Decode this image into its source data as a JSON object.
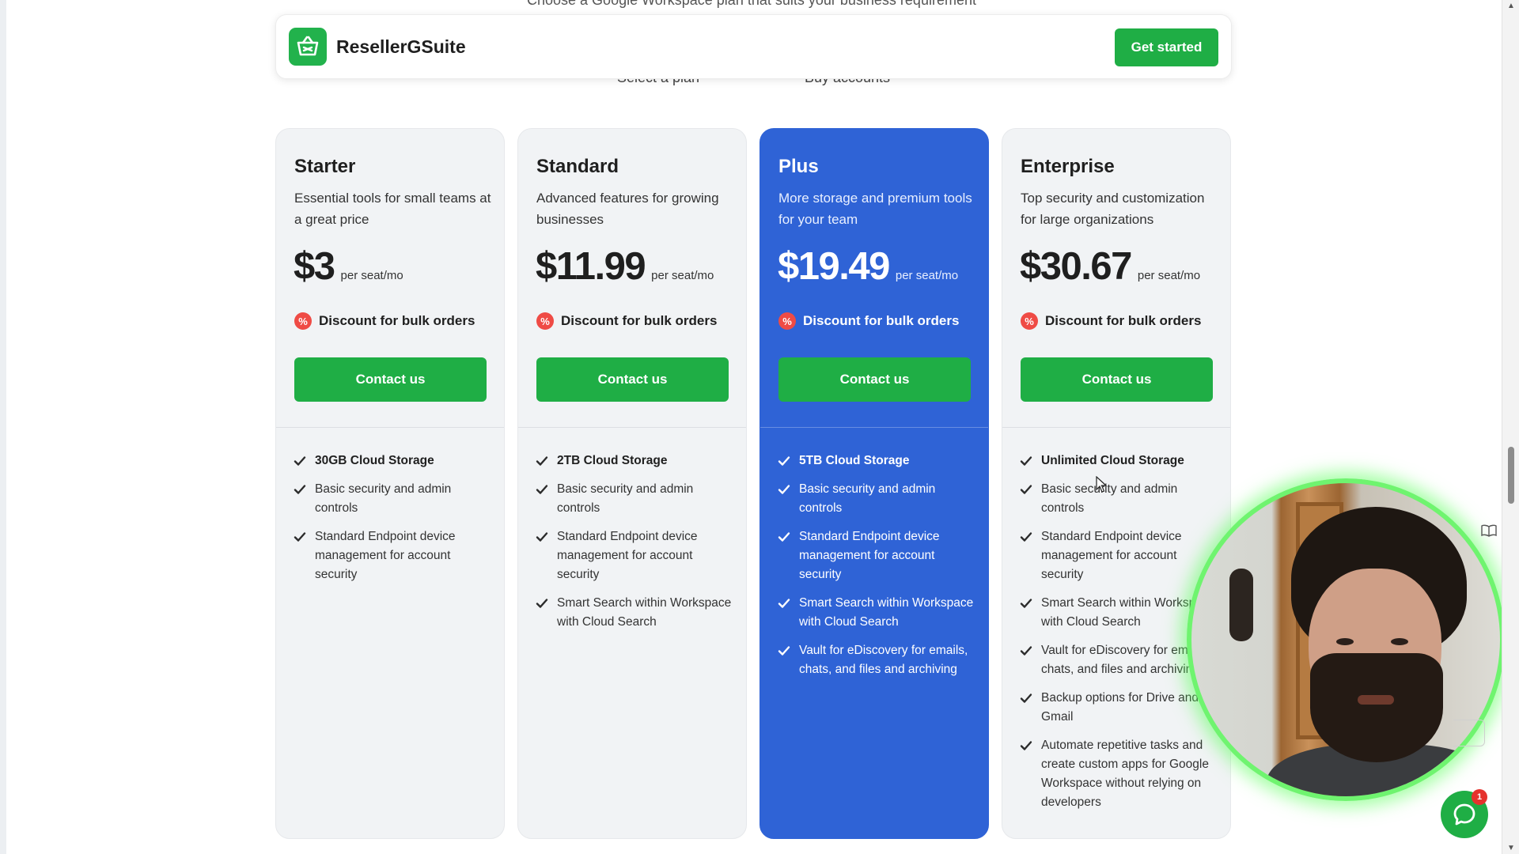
{
  "page": {
    "cut_heading": "Choose a Google Workspace plan that suits your business requirement",
    "steps": [
      "Select a plan",
      "Buy accounts"
    ]
  },
  "navbar": {
    "brand": "ResellerGSuite",
    "logo_icon": "shopping-basket-icon",
    "cta_label": "Get started"
  },
  "plans": [
    {
      "name": "Starter",
      "description": "Essential tools for small teams at a great price",
      "price": "$3",
      "per": "per seat/mo",
      "discount": "Discount for bulk orders",
      "button": "Contact us",
      "featured": false,
      "features": [
        {
          "text": "30GB Cloud Storage",
          "bold": true
        },
        {
          "text": "Basic security and admin controls",
          "bold": false
        },
        {
          "text": "Standard Endpoint device management for account security",
          "bold": false
        }
      ]
    },
    {
      "name": "Standard",
      "description": "Advanced features for growing businesses",
      "price": "$11.99",
      "per": "per seat/mo",
      "discount": "Discount for bulk orders",
      "button": "Contact us",
      "featured": false,
      "features": [
        {
          "text": "2TB Cloud Storage",
          "bold": true
        },
        {
          "text": "Basic security and admin controls",
          "bold": false
        },
        {
          "text": "Standard Endpoint device management for account security",
          "bold": false
        },
        {
          "text": "Smart Search within Workspace with Cloud Search",
          "bold": false
        }
      ]
    },
    {
      "name": "Plus",
      "description": "More storage and premium tools for your team",
      "price": "$19.49",
      "per": "per seat/mo",
      "discount": "Discount for bulk orders",
      "button": "Contact us",
      "featured": true,
      "features": [
        {
          "text": "5TB Cloud Storage",
          "bold": true
        },
        {
          "text": "Basic security and admin controls",
          "bold": false
        },
        {
          "text": "Standard Endpoint device management for account security",
          "bold": false
        },
        {
          "text": "Smart Search within Workspace with Cloud Search",
          "bold": false
        },
        {
          "text": "Vault for eDiscovery for emails, chats, and files and archiving",
          "bold": false
        }
      ]
    },
    {
      "name": "Enterprise",
      "description": "Top security and customization for large organizations",
      "price": "$30.67",
      "per": "per seat/mo",
      "discount": "Discount for bulk orders",
      "button": "Contact us",
      "featured": false,
      "features": [
        {
          "text": "Unlimited Cloud Storage",
          "bold": true
        },
        {
          "text": "Basic security and admin controls",
          "bold": false
        },
        {
          "text": "Standard Endpoint device management for account security",
          "bold": false
        },
        {
          "text": "Smart Search within Workspace with Cloud Search",
          "bold": false
        },
        {
          "text": "Vault for eDiscovery for emails, chats, and files and archiving",
          "bold": false
        },
        {
          "text": "Backup options for Drive and Gmail",
          "bold": false
        },
        {
          "text": "Automate repetitive tasks and create custom apps for Google Workspace without relying on developers",
          "bold": false
        }
      ]
    }
  ],
  "chat_widget": {
    "badge": "1",
    "icon": "chat-bubble-icon"
  },
  "colors": {
    "green": "#1fae45",
    "blue": "#2f63d6",
    "card_bg": "#f1f3f5",
    "discount_red": "#ef4b45",
    "overlay_ring": "#6ff46f"
  }
}
